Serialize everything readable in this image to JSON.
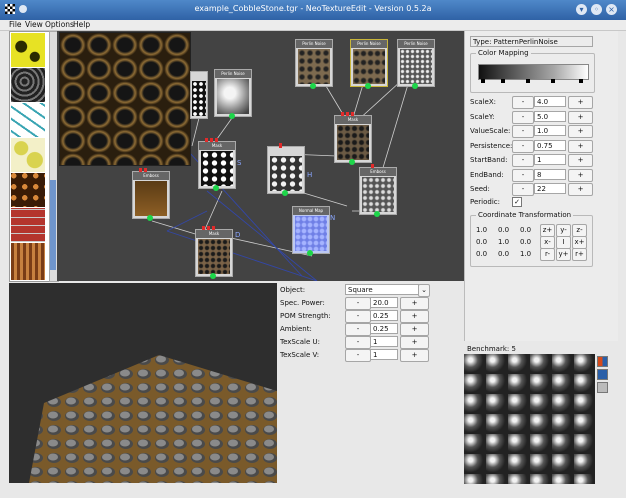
{
  "window": {
    "title": "example_CobbleStone.tgr - NeoTextureEdit - Version 0.5.2a"
  },
  "menu": [
    "File",
    "View",
    "Options",
    "Help"
  ],
  "thumbnails": [
    {
      "name": "yellow-blob-texture"
    },
    {
      "name": "dark-cells-texture"
    },
    {
      "name": "teal-pattern-texture"
    },
    {
      "name": "yellow-cells-texture"
    },
    {
      "name": "brown-cobble-texture"
    },
    {
      "name": "brick-texture"
    },
    {
      "name": "wood-texture"
    }
  ],
  "graph": {
    "nodes": [
      {
        "label": "Perlin Noise"
      },
      {
        "label": "Perlin Noise"
      },
      {
        "label": "Perlin Noise"
      },
      {
        "label": "Perlin Noise"
      },
      {
        "label": "Mask"
      },
      {
        "label": "Emboss"
      },
      {
        "label": "Emboss"
      },
      {
        "label": "Mask"
      },
      {
        "label": "Normal Map"
      },
      {
        "label": "Mask"
      }
    ],
    "edge_labels": [
      "S",
      "H",
      "N",
      "D"
    ]
  },
  "properties": {
    "type_label": "Type: PatternPerlinNoise",
    "color_mapping_label": "Color Mapping",
    "params": [
      {
        "label": "ScaleX:",
        "value": "4.0"
      },
      {
        "label": "ScaleY:",
        "value": "5.0"
      },
      {
        "label": "ValueScale:",
        "value": "1.0"
      },
      {
        "label": "Persistence:",
        "value": "0.75"
      },
      {
        "label": "StartBand:",
        "value": "1"
      },
      {
        "label": "EndBand:",
        "value": "8"
      },
      {
        "label": "Seed:",
        "value": "22"
      }
    ],
    "minus": "-",
    "plus": "+",
    "periodic_label": "Periodic:",
    "periodic_checked": "✓",
    "coord_title": "Coordinate Transformation",
    "matrix": [
      [
        "1.0",
        "0.0",
        "0.0"
      ],
      [
        "0.0",
        "1.0",
        "0.0"
      ],
      [
        "0.0",
        "0.0",
        "1.0"
      ]
    ],
    "coord_buttons": [
      [
        "z+",
        "y-",
        "z-"
      ],
      [
        "x-",
        "I",
        "x+"
      ],
      [
        "r-",
        "y+",
        "r+"
      ]
    ]
  },
  "preview": {
    "object_label": "Object:",
    "object_value": "Square",
    "params": [
      {
        "label": "Spec. Power:",
        "value": "20.0"
      },
      {
        "label": "POM Strength:",
        "value": "0.25"
      },
      {
        "label": "Ambient:",
        "value": "0.25"
      },
      {
        "label": "TexScale U:",
        "value": "1"
      },
      {
        "label": "TexScale V:",
        "value": "1"
      }
    ]
  },
  "benchmark": {
    "label": "Benchmark: 5"
  },
  "colors": {
    "titlebar": "#3f73b8",
    "graph_bg": "#434343",
    "port": "#1dd64a",
    "accent": "#6f95cc"
  }
}
